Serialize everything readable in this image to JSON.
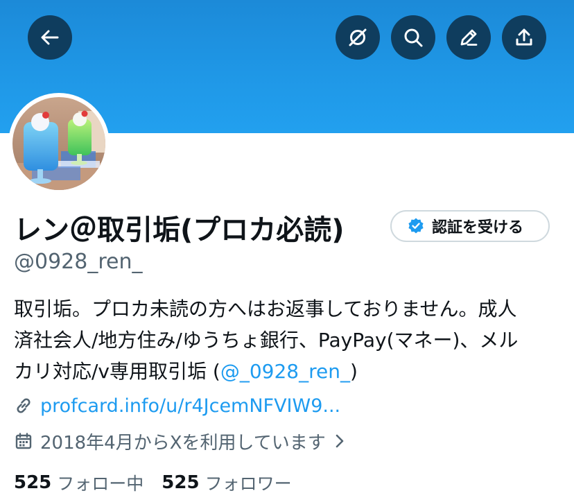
{
  "header": {
    "back_icon": "arrow-left-icon",
    "actions": [
      "lock-slash-icon",
      "search-icon",
      "edit-icon",
      "share-icon"
    ]
  },
  "profile": {
    "display_name": "レン＠取引垢(プロカ必読)",
    "verify_button_label": "認証を受ける",
    "handle": "@0928_ren_",
    "bio_lines": [
      "取引垢。プロカ未読の方へはお返事しておりません。成人",
      "済社会人/地方住み/ゆうちょ銀行、PayPay(マネー)、メル",
      "カリ対応/v専用取引垢 ("
    ],
    "bio_mention": "@_0928_ren_",
    "bio_suffix": ")",
    "link": "profcard.info/u/r4JcemNFVIW9...",
    "joined": "2018年4月からXを利用しています",
    "following_count": "525",
    "following_label": "フォロー中",
    "followers_count": "525",
    "followers_label": "フォロワー"
  },
  "colors": {
    "banner": "#1f97e6",
    "button_bg": "#0f3d5e",
    "link": "#1d9bf0",
    "secondary_text": "#536471",
    "primary_text": "#0f1419",
    "verified_badge": "#1d9bf0"
  }
}
